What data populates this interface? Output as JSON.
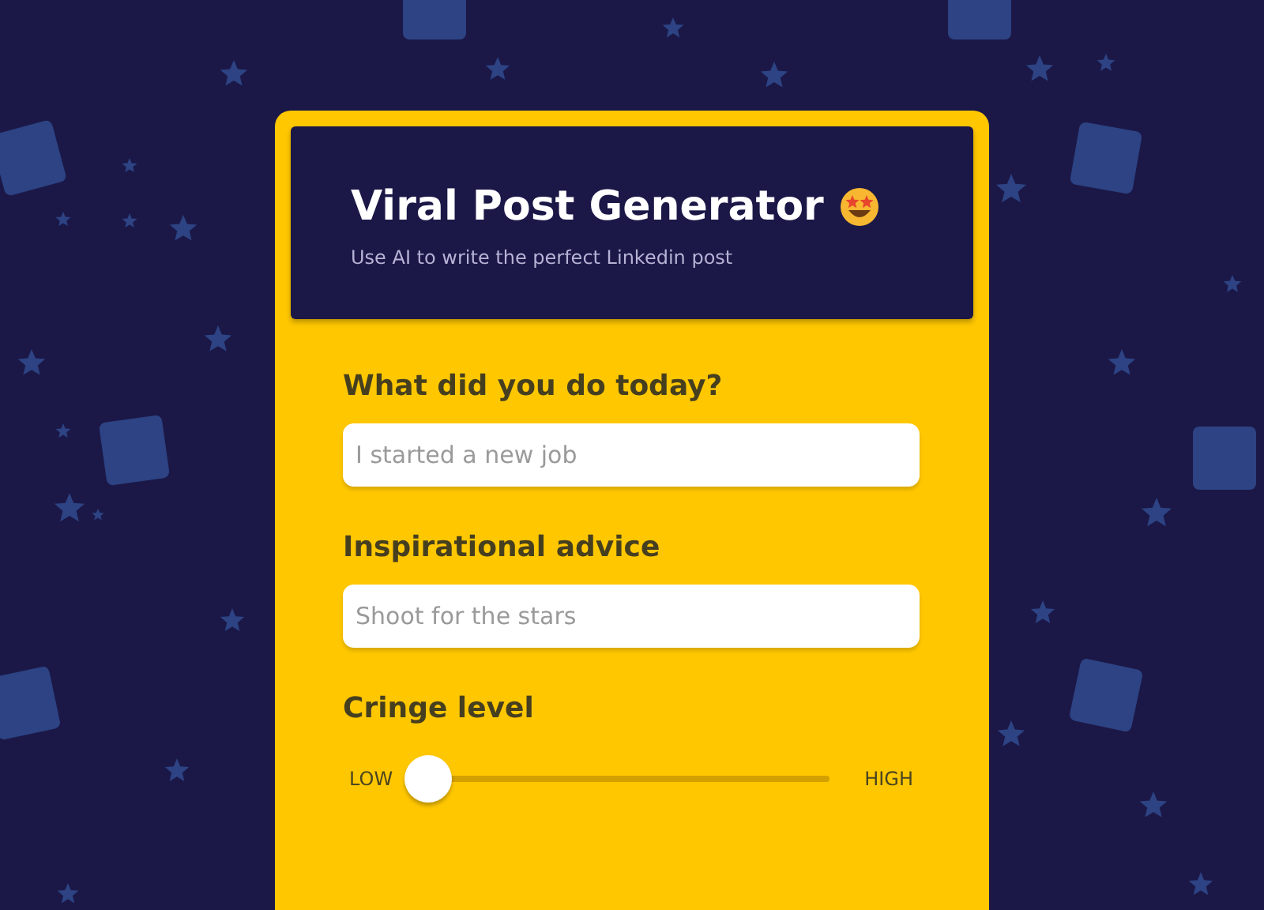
{
  "header": {
    "title": "Viral Post Generator",
    "subtitle": "Use AI to write the perfect Linkedin post"
  },
  "fields": [
    {
      "label": "What did you do today?",
      "placeholder": "I started a new job"
    },
    {
      "label": "Inspirational advice",
      "placeholder": "Shoot for the stars"
    }
  ],
  "slider": {
    "label": "Cringe level",
    "min_label": "LOW",
    "max_label": "HIGH",
    "level": 0
  }
}
